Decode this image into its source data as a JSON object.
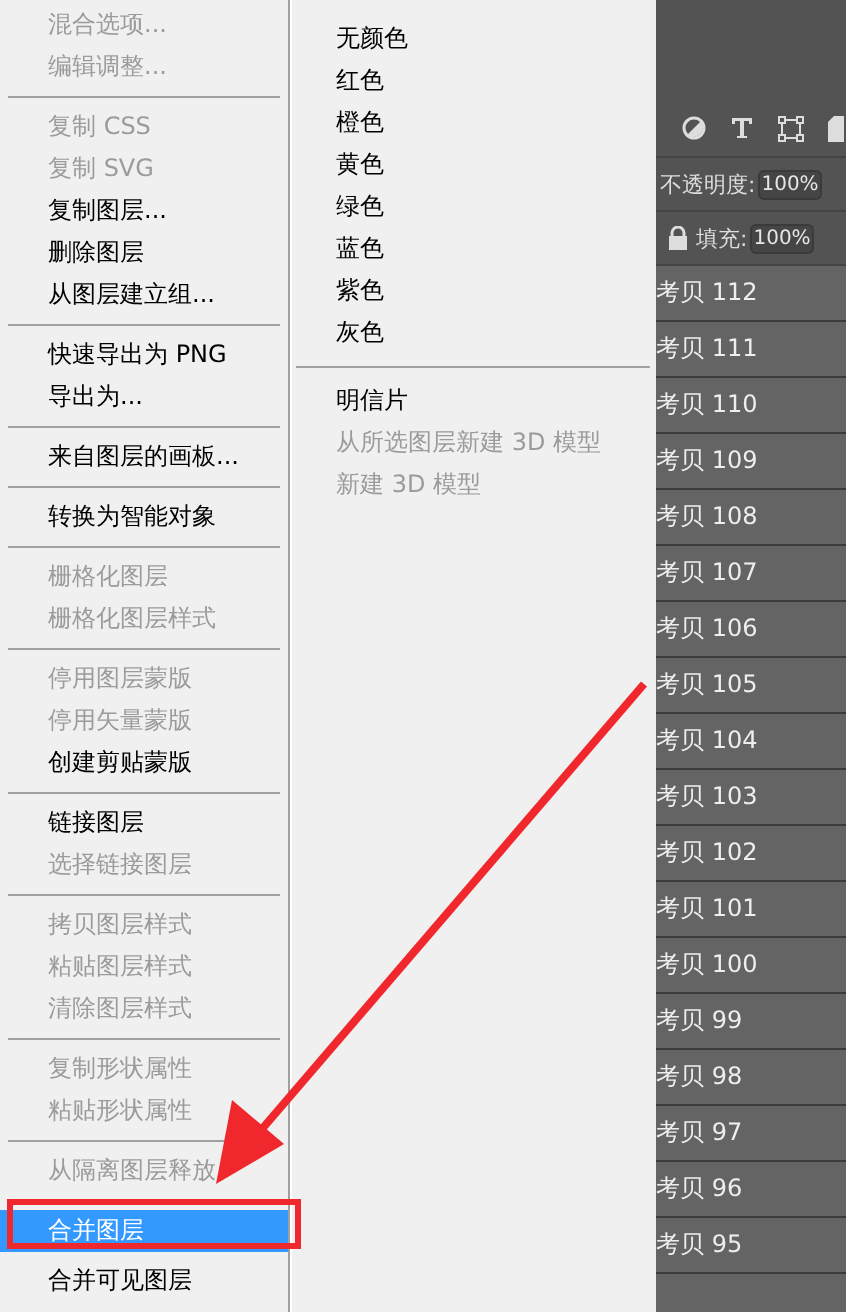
{
  "context_menu": {
    "items": [
      {
        "kind": "item",
        "label": "混合选项...",
        "disabled": true,
        "selected": false
      },
      {
        "kind": "item",
        "label": "编辑调整...",
        "disabled": true,
        "selected": false
      },
      {
        "kind": "separator"
      },
      {
        "kind": "item",
        "label": "复制 CSS",
        "disabled": true,
        "selected": false
      },
      {
        "kind": "item",
        "label": "复制 SVG",
        "disabled": true,
        "selected": false
      },
      {
        "kind": "item",
        "label": "复制图层...",
        "disabled": false,
        "selected": false
      },
      {
        "kind": "item",
        "label": "删除图层",
        "disabled": false,
        "selected": false
      },
      {
        "kind": "item",
        "label": "从图层建立组...",
        "disabled": false,
        "selected": false
      },
      {
        "kind": "separator"
      },
      {
        "kind": "item",
        "label": "快速导出为 PNG",
        "disabled": false,
        "selected": false
      },
      {
        "kind": "item",
        "label": "导出为...",
        "disabled": false,
        "selected": false
      },
      {
        "kind": "separator"
      },
      {
        "kind": "item",
        "label": "来自图层的画板...",
        "disabled": false,
        "selected": false
      },
      {
        "kind": "separator"
      },
      {
        "kind": "item",
        "label": "转换为智能对象",
        "disabled": false,
        "selected": false
      },
      {
        "kind": "separator"
      },
      {
        "kind": "item",
        "label": "栅格化图层",
        "disabled": true,
        "selected": false
      },
      {
        "kind": "item",
        "label": "栅格化图层样式",
        "disabled": true,
        "selected": false
      },
      {
        "kind": "separator"
      },
      {
        "kind": "item",
        "label": "停用图层蒙版",
        "disabled": true,
        "selected": false
      },
      {
        "kind": "item",
        "label": "停用矢量蒙版",
        "disabled": true,
        "selected": false
      },
      {
        "kind": "item",
        "label": "创建剪贴蒙版",
        "disabled": false,
        "selected": false
      },
      {
        "kind": "separator"
      },
      {
        "kind": "item",
        "label": "链接图层",
        "disabled": false,
        "selected": false
      },
      {
        "kind": "item",
        "label": "选择链接图层",
        "disabled": true,
        "selected": false
      },
      {
        "kind": "separator"
      },
      {
        "kind": "item",
        "label": "拷贝图层样式",
        "disabled": true,
        "selected": false
      },
      {
        "kind": "item",
        "label": "粘贴图层样式",
        "disabled": true,
        "selected": false
      },
      {
        "kind": "item",
        "label": "清除图层样式",
        "disabled": true,
        "selected": false
      },
      {
        "kind": "separator"
      },
      {
        "kind": "item",
        "label": "复制形状属性",
        "disabled": true,
        "selected": false
      },
      {
        "kind": "item",
        "label": "粘贴形状属性",
        "disabled": true,
        "selected": false
      },
      {
        "kind": "separator"
      },
      {
        "kind": "item",
        "label": "从隔离图层释放",
        "disabled": true,
        "selected": false
      },
      {
        "kind": "separator"
      },
      {
        "kind": "item",
        "label": "合并图层",
        "disabled": false,
        "selected": true
      },
      {
        "kind": "item",
        "label": "合并可见图层",
        "disabled": false,
        "selected": false
      }
    ]
  },
  "color_menu": {
    "items": [
      {
        "kind": "item",
        "label": "无颜色",
        "disabled": false
      },
      {
        "kind": "item",
        "label": "红色",
        "disabled": false
      },
      {
        "kind": "item",
        "label": "橙色",
        "disabled": false
      },
      {
        "kind": "item",
        "label": "黄色",
        "disabled": false
      },
      {
        "kind": "item",
        "label": "绿色",
        "disabled": false
      },
      {
        "kind": "item",
        "label": "蓝色",
        "disabled": false
      },
      {
        "kind": "item",
        "label": "紫色",
        "disabled": false
      },
      {
        "kind": "item",
        "label": "灰色",
        "disabled": false
      },
      {
        "kind": "separator"
      },
      {
        "kind": "item",
        "label": "明信片",
        "disabled": false
      },
      {
        "kind": "item",
        "label": "从所选图层新建 3D 模型",
        "disabled": true
      },
      {
        "kind": "item",
        "label": "新建 3D 模型",
        "disabled": true
      }
    ]
  },
  "layers_panel": {
    "opacity_label": "不透明度:",
    "opacity_value": "100%",
    "fill_label": "填充:",
    "fill_value": "100%",
    "layers": [
      "考贝 112",
      "考贝 111",
      "考贝 110",
      "考贝 109",
      "考贝 108",
      "考贝 107",
      "考贝 106",
      "考贝 105",
      "考贝 104",
      "考贝 103",
      "考贝 102",
      "考贝 101",
      "考贝 100",
      "考贝 99",
      "考贝 98",
      "考贝 97",
      "考贝 96",
      "考贝 95"
    ]
  }
}
